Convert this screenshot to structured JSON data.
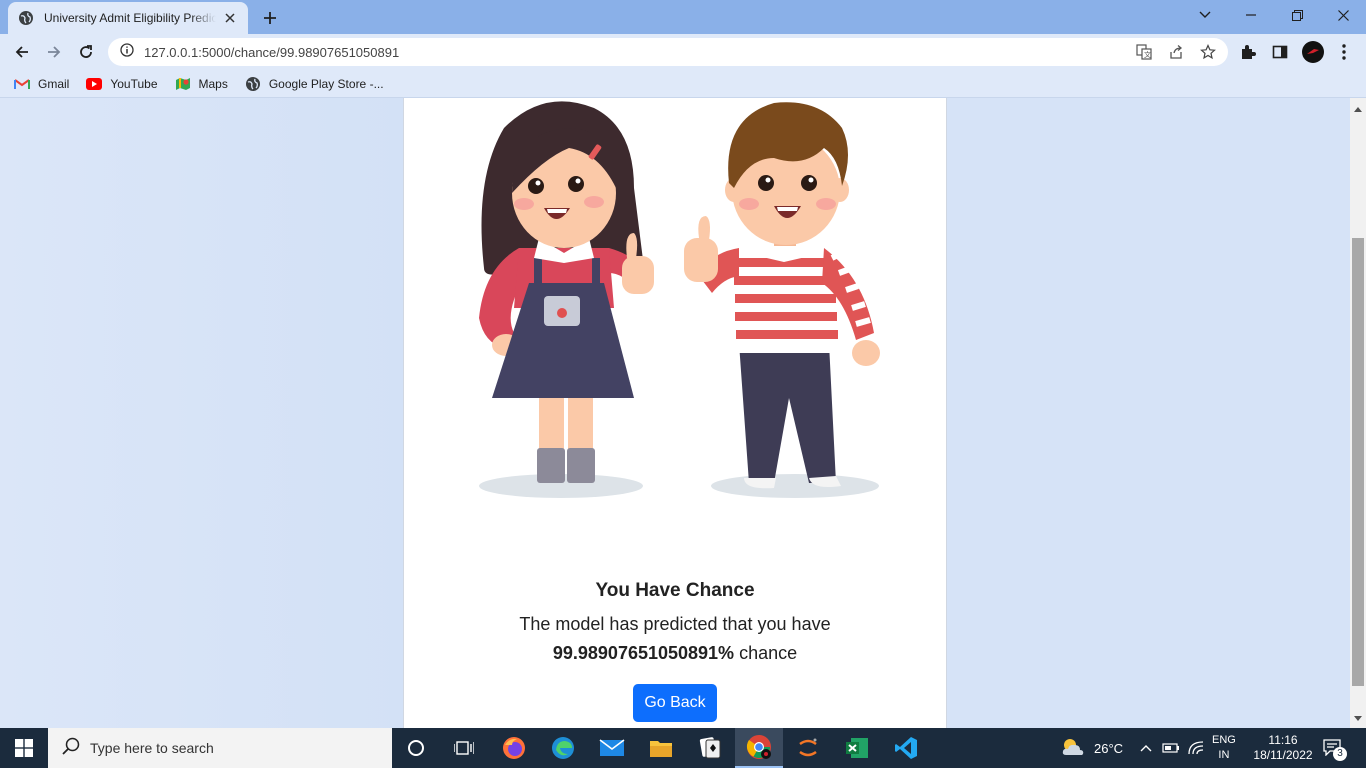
{
  "browser": {
    "tab_title": "University Admit Eligibility Predic",
    "url": "127.0.0.1:5000/chance/99.98907651050891",
    "bookmarks": [
      {
        "label": "Gmail",
        "icon": "gmail-icon"
      },
      {
        "label": "YouTube",
        "icon": "youtube-icon"
      },
      {
        "label": "Maps",
        "icon": "maps-icon"
      },
      {
        "label": "Google Play Store -...",
        "icon": "globe-icon"
      }
    ]
  },
  "page": {
    "heading": "You Have Chance",
    "message_prefix": "The model has predicted that you have",
    "chance_value": "99.98907651050891%",
    "chance_suffix": "chance",
    "go_back_label": "Go Back"
  },
  "taskbar": {
    "search_placeholder": "Type here to search",
    "weather_temp": "26°C",
    "language_top": "ENG",
    "language_bottom": "IN",
    "time": "11:16",
    "date": "18/11/2022",
    "notification_count": "3"
  },
  "colors": {
    "accent_button": "#0d6efd",
    "tabbar": "#8ab0e8",
    "taskbar": "#1b2b3d"
  }
}
